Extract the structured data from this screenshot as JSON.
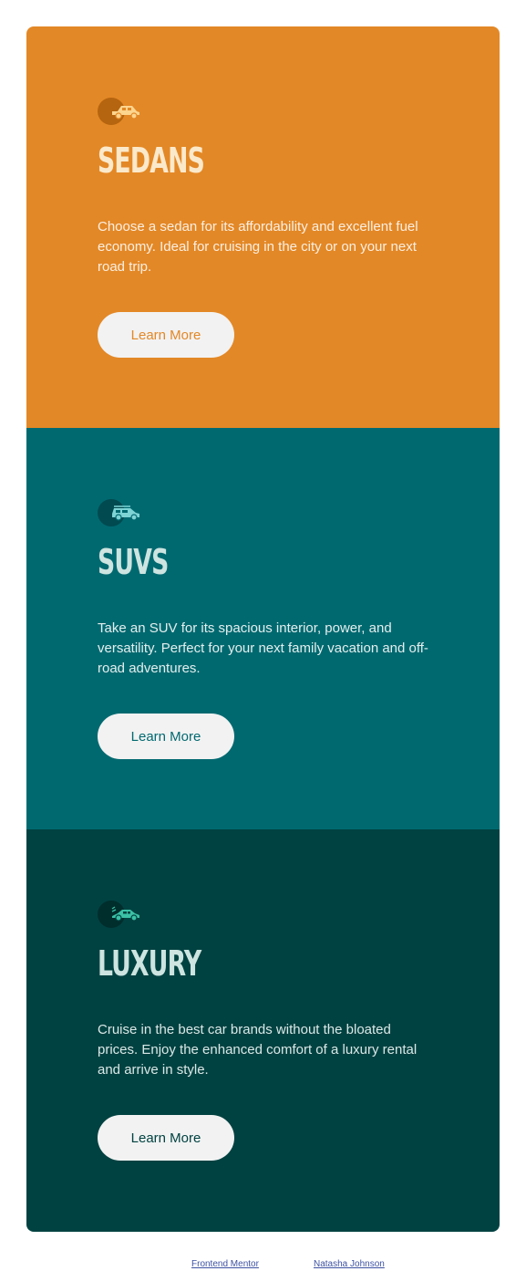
{
  "colors": {
    "sedans_bg": "#e38826",
    "suvs_bg": "#006970",
    "luxury_bg": "#004241",
    "heading_light": "#f2f2f2",
    "sedans_heading": "#fbe9cb",
    "sedans_button_text": "#e38826",
    "suvs_heading": "#cde4e0",
    "suvs_button_text": "#006970",
    "luxury_heading": "#cde4e0",
    "luxury_button_text": "#004241"
  },
  "cards": [
    {
      "icon": "sedan-car-icon",
      "title": "SEDANS",
      "description": "Choose a sedan for its affordability and excellent fuel economy. Ideal for cruising in the city or on your next road trip.",
      "button_label": "Learn More"
    },
    {
      "icon": "suv-car-icon",
      "title": "SUVS",
      "description": "Take an SUV for its spacious interior, power, and versatility. Perfect for your next family vacation and off-road adventures.",
      "button_label": "Learn More"
    },
    {
      "icon": "luxury-car-icon",
      "title": "LUXURY",
      "description": "Cruise in the best car brands without the bloated prices. Enjoy the enhanced comfort of a luxury rental and arrive in style.",
      "button_label": "Learn More"
    }
  ],
  "footer": {
    "link_1": "Frontend Mentor",
    "link_2": "Natasha Johnson"
  }
}
